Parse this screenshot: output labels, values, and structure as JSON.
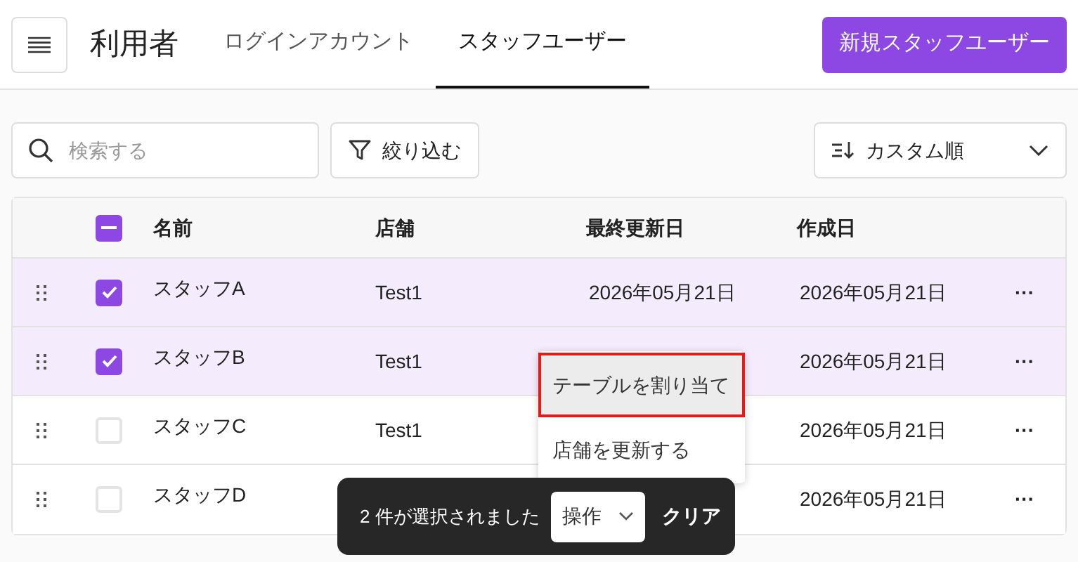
{
  "header": {
    "title": "利用者",
    "tabs": [
      {
        "label": "ログインアカウント",
        "selected": false
      },
      {
        "label": "スタッフユーザー",
        "selected": true
      }
    ],
    "new_button": "新規スタッフユーザー"
  },
  "toolbar": {
    "search": {
      "placeholder": "検索する"
    },
    "filter_button": "絞り込む",
    "sort": {
      "value": "カスタム順"
    }
  },
  "table": {
    "select_all_indeterminate": true,
    "columns": [
      "名前",
      "店舗",
      "最終更新日",
      "作成日"
    ],
    "rows": [
      {
        "selected": true,
        "name": "スタッフA",
        "store": "Test1",
        "updated": "2026年05月21日",
        "created": "2026年05月21日",
        "more": "···"
      },
      {
        "selected": true,
        "name": "スタッフB",
        "store": "Test1",
        "created": "2026年05月21日",
        "more": "···"
      },
      {
        "selected": false,
        "name": "スタッフC",
        "store": "Test1",
        "created": "2026年05月21日",
        "more": "···"
      },
      {
        "selected": false,
        "name": "スタッフD",
        "created": "2026年05月21日",
        "more": "···"
      }
    ]
  },
  "action_menu": {
    "items": [
      {
        "label": "テーブルを割り当て",
        "highlighted": true
      },
      {
        "label": "店舗を更新する",
        "highlighted": false
      }
    ]
  },
  "selection_bar": {
    "count_text": "2 件が選択されました",
    "action_select": "操作",
    "clear_button": "クリア"
  }
}
